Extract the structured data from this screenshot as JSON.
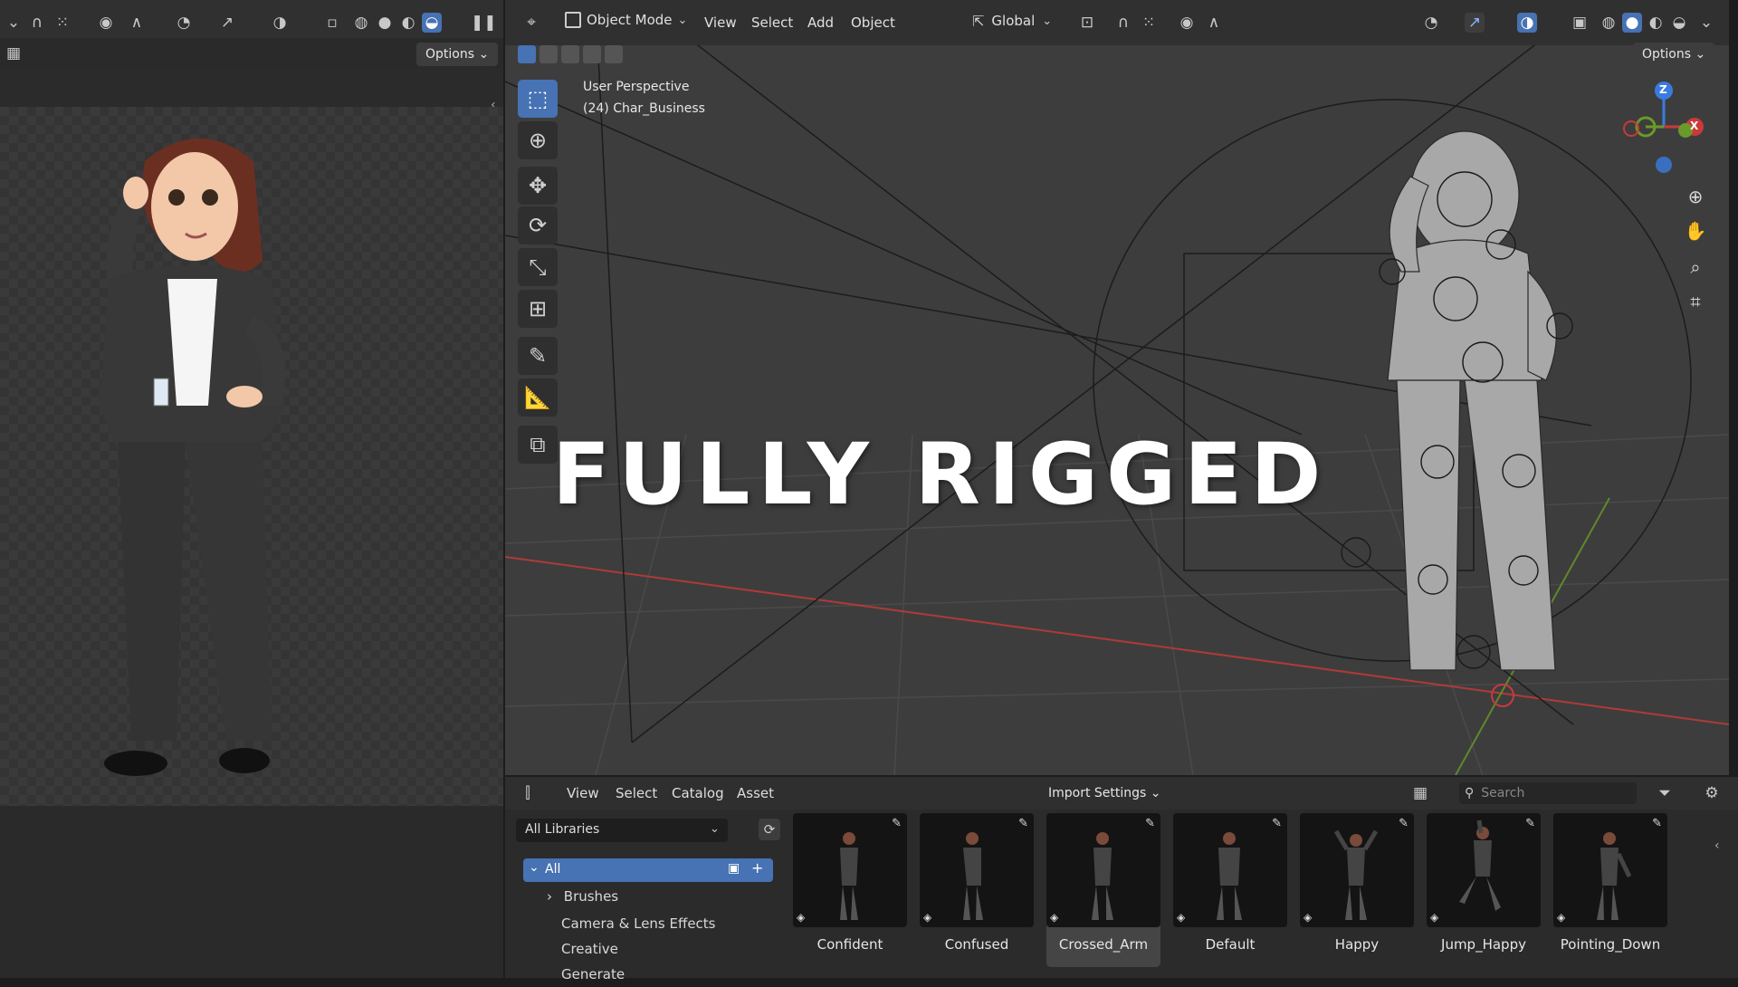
{
  "left_editor": {
    "options_label": "Options"
  },
  "viewport": {
    "mode_label": "Object Mode",
    "menu": [
      "View",
      "Select",
      "Add",
      "Object"
    ],
    "transform_orientation": "Global",
    "options_label": "Options",
    "perspective_label": "User Perspective",
    "object_label": "(24) Char_Business",
    "gizmo_axes": [
      "Z",
      "X"
    ]
  },
  "overlay_title": "FULLY RIGGED",
  "asset_browser": {
    "menu": [
      "View",
      "Select",
      "Catalog",
      "Asset"
    ],
    "import_settings_label": "Import Settings",
    "search_placeholder": "Search",
    "library_selector": "All Libraries",
    "tree": {
      "root": "All",
      "children": [
        "Brushes",
        "Camera & Lens Effects",
        "Creative",
        "Generate"
      ]
    },
    "assets": [
      "Confident",
      "Confused",
      "Crossed_Arm",
      "Default",
      "Happy",
      "Jump_Happy",
      "Pointing_Down"
    ],
    "selected_asset": "Crossed_Arm"
  },
  "colors": {
    "accent_blue": "#4772b3",
    "axis_red": "#c93a3a",
    "axis_green": "#6a9a2a"
  }
}
